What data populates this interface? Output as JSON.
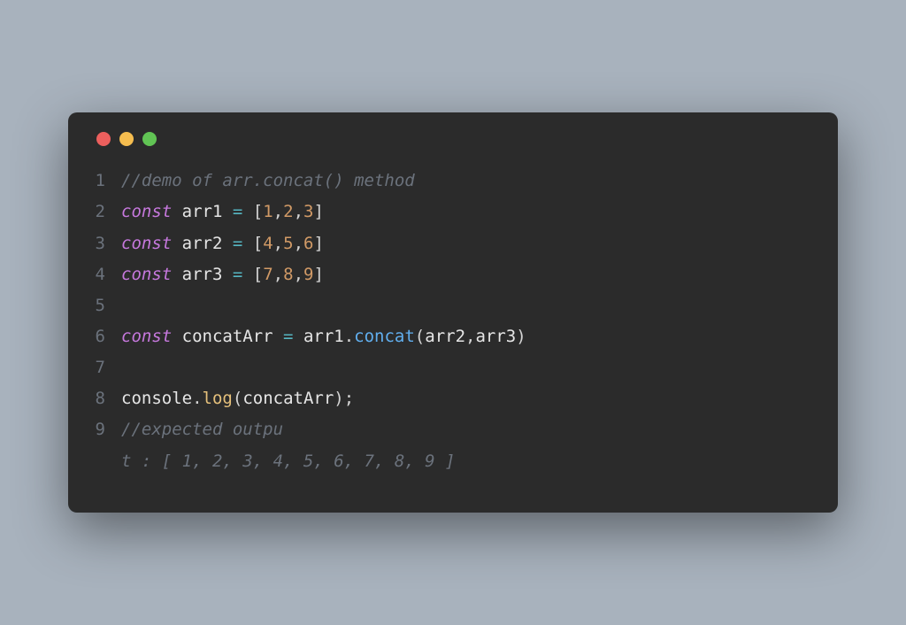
{
  "window": {
    "traffic": [
      "red",
      "yellow",
      "green"
    ]
  },
  "code": {
    "lines": [
      {
        "n": "1",
        "tokens": [
          {
            "c": "comment",
            "t": "//demo of arr.concat() method"
          }
        ]
      },
      {
        "n": "2",
        "tokens": [
          {
            "c": "keyword",
            "t": "const"
          },
          {
            "c": "ident",
            "t": " arr1 "
          },
          {
            "c": "op",
            "t": "="
          },
          {
            "c": "ident",
            "t": " "
          },
          {
            "c": "punct",
            "t": "["
          },
          {
            "c": "num",
            "t": "1"
          },
          {
            "c": "punct",
            "t": ","
          },
          {
            "c": "num",
            "t": "2"
          },
          {
            "c": "punct",
            "t": ","
          },
          {
            "c": "num",
            "t": "3"
          },
          {
            "c": "punct",
            "t": "]"
          }
        ]
      },
      {
        "n": "3",
        "tokens": [
          {
            "c": "keyword",
            "t": "const"
          },
          {
            "c": "ident",
            "t": " arr2 "
          },
          {
            "c": "op",
            "t": "="
          },
          {
            "c": "ident",
            "t": " "
          },
          {
            "c": "punct",
            "t": "["
          },
          {
            "c": "num",
            "t": "4"
          },
          {
            "c": "punct",
            "t": ","
          },
          {
            "c": "num",
            "t": "5"
          },
          {
            "c": "punct",
            "t": ","
          },
          {
            "c": "num",
            "t": "6"
          },
          {
            "c": "punct",
            "t": "]"
          }
        ]
      },
      {
        "n": "4",
        "tokens": [
          {
            "c": "keyword",
            "t": "const"
          },
          {
            "c": "ident",
            "t": " arr3 "
          },
          {
            "c": "op",
            "t": "="
          },
          {
            "c": "ident",
            "t": " "
          },
          {
            "c": "punct",
            "t": "["
          },
          {
            "c": "num",
            "t": "7"
          },
          {
            "c": "punct",
            "t": ","
          },
          {
            "c": "num",
            "t": "8"
          },
          {
            "c": "punct",
            "t": ","
          },
          {
            "c": "num",
            "t": "9"
          },
          {
            "c": "punct",
            "t": "]"
          }
        ]
      },
      {
        "n": "5",
        "tokens": [
          {
            "c": "ident",
            "t": ""
          }
        ]
      },
      {
        "n": "6",
        "tokens": [
          {
            "c": "keyword",
            "t": "const"
          },
          {
            "c": "ident",
            "t": " concatArr "
          },
          {
            "c": "op",
            "t": "="
          },
          {
            "c": "ident",
            "t": " arr1"
          },
          {
            "c": "punct",
            "t": "."
          },
          {
            "c": "func",
            "t": "concat"
          },
          {
            "c": "punct",
            "t": "("
          },
          {
            "c": "ident",
            "t": "arr2"
          },
          {
            "c": "punct",
            "t": ","
          },
          {
            "c": "ident",
            "t": "arr3"
          },
          {
            "c": "punct",
            "t": ")"
          }
        ]
      },
      {
        "n": "7",
        "tokens": [
          {
            "c": "ident",
            "t": ""
          }
        ]
      },
      {
        "n": "8",
        "tokens": [
          {
            "c": "ident",
            "t": "console"
          },
          {
            "c": "punct",
            "t": "."
          },
          {
            "c": "method",
            "t": "log"
          },
          {
            "c": "punct",
            "t": "("
          },
          {
            "c": "ident",
            "t": "concatArr"
          },
          {
            "c": "punct",
            "t": ");"
          }
        ]
      },
      {
        "n": "9",
        "tokens": [
          {
            "c": "comment",
            "t": "//expected outpu"
          }
        ]
      },
      {
        "n": "",
        "tokens": [
          {
            "c": "comment",
            "t": "t : [ 1, 2, 3, 4, 5, 6, 7, 8, 9 ]"
          }
        ]
      }
    ]
  }
}
